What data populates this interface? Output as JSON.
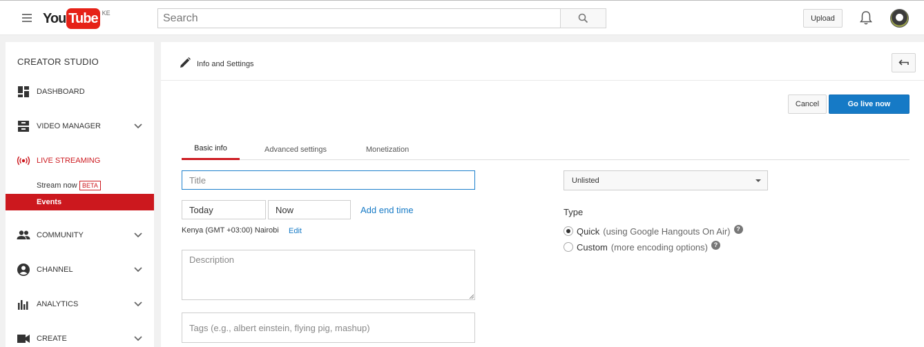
{
  "header": {
    "logo_you": "You",
    "logo_tube": "Tube",
    "country_code": "KE",
    "search_placeholder": "Search",
    "upload_label": "Upload"
  },
  "sidebar": {
    "title": "CREATOR STUDIO",
    "items": [
      {
        "label": "DASHBOARD",
        "icon": "dashboard-icon"
      },
      {
        "label": "VIDEO MANAGER",
        "icon": "video-manager-icon"
      },
      {
        "label": "LIVE STREAMING",
        "icon": "live-streaming-icon"
      },
      {
        "label": "COMMUNITY",
        "icon": "community-icon"
      },
      {
        "label": "CHANNEL",
        "icon": "channel-icon"
      },
      {
        "label": "ANALYTICS",
        "icon": "analytics-icon"
      },
      {
        "label": "CREATE",
        "icon": "create-icon"
      }
    ],
    "live_sub": {
      "stream_now": "Stream now",
      "beta": "BETA",
      "events": "Events"
    }
  },
  "main": {
    "header_title": "Info and Settings",
    "cancel_label": "Cancel",
    "go_live_label": "Go live now",
    "tabs": [
      {
        "label": "Basic info"
      },
      {
        "label": "Advanced settings"
      },
      {
        "label": "Monetization"
      }
    ],
    "form": {
      "title_placeholder": "Title",
      "date_value": "Today",
      "time_value": "Now",
      "add_end_time": "Add end time",
      "timezone": "Kenya (GMT +03:00) Nairobi",
      "edit_label": "Edit",
      "description_placeholder": "Description",
      "tags_placeholder": "Tags (e.g., albert einstein, flying pig, mashup)"
    },
    "privacy_value": "Unlisted",
    "type": {
      "title": "Type",
      "options": [
        {
          "label": "Quick",
          "hint": "(using Google Hangouts On Air)",
          "selected": true
        },
        {
          "label": "Custom",
          "hint": "(more encoding options)",
          "selected": false
        }
      ],
      "help_glyph": "?"
    }
  },
  "colors": {
    "brand_red": "#cc181e",
    "primary_blue": "#167ac6"
  }
}
